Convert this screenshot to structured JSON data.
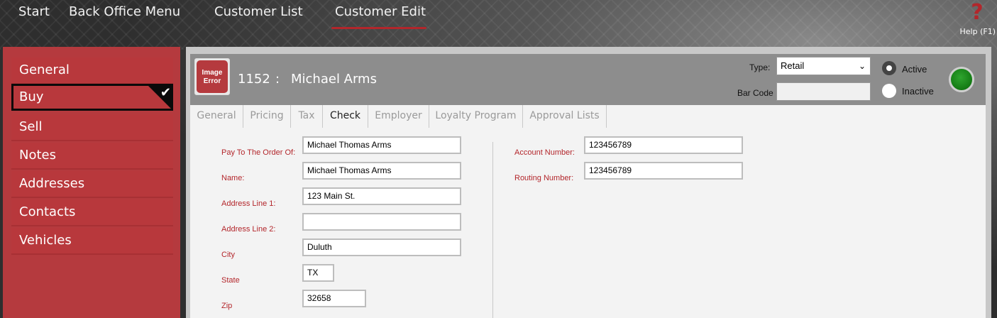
{
  "topnav": {
    "start": "Start",
    "back_office": "Back Office Menu",
    "customer_list": "Customer List",
    "customer_edit": "Customer Edit",
    "help_icon": "question-mark-icon",
    "help_label": "Help (F1)"
  },
  "sidebar": {
    "items": [
      {
        "label": "General"
      },
      {
        "label": "Buy"
      },
      {
        "label": "Sell"
      },
      {
        "label": "Notes"
      },
      {
        "label": "Addresses"
      },
      {
        "label": "Contacts"
      },
      {
        "label": "Vehicles"
      }
    ],
    "selected_index": 1,
    "check_icon": "✔"
  },
  "header": {
    "image_error": "Image Error",
    "customer_id": "1152",
    "separator": ":",
    "customer_name": "Michael Arms",
    "type_label": "Type:",
    "type_value": "Retail",
    "barcode_label": "Bar Code",
    "barcode_value": "",
    "active_label": "Active",
    "inactive_label": "Inactive",
    "status_color": "#1a8a1a"
  },
  "tabs": [
    {
      "label": "General"
    },
    {
      "label": "Pricing"
    },
    {
      "label": "Tax"
    },
    {
      "label": "Check"
    },
    {
      "label": "Employer"
    },
    {
      "label": "Loyalty Program"
    },
    {
      "label": "Approval Lists"
    }
  ],
  "active_tab": "Check",
  "form": {
    "pay_to_label": "Pay To The Order Of:",
    "pay_to_value": "Michael Thomas Arms",
    "name_label": "Name:",
    "name_value": "Michael Thomas Arms",
    "addr1_label": "Address Line 1:",
    "addr1_value": "123 Main St.",
    "addr2_label": "Address Line 2:",
    "addr2_value": "",
    "city_label": "City",
    "city_value": "Duluth",
    "state_label": "State",
    "state_value": "TX",
    "zip_label": "Zip",
    "zip_value": "32658",
    "account_label": "Account Number:",
    "account_value": "123456789",
    "routing_label": "Routing Number:",
    "routing_value": "123456789"
  },
  "colors": {
    "accent": "#b3262b",
    "sidebar": "#b53a3e",
    "header": "#8d8d8d"
  }
}
